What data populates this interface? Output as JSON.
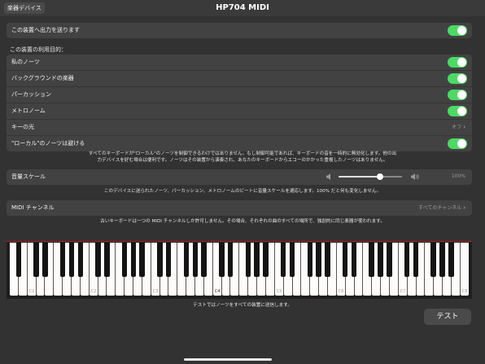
{
  "header": {
    "back_label": "楽器デバイス",
    "title": "HP704 MIDI"
  },
  "send_all": {
    "label": "この装置へ出力を送ります",
    "on": true
  },
  "usage_section": {
    "heading": "この装置の利用目的：",
    "items": [
      {
        "label": "私のノーツ",
        "on": true
      },
      {
        "label": "バックグラウンドの楽器",
        "on": true
      },
      {
        "label": "パーカッション",
        "on": true
      },
      {
        "label": "メトロノーム",
        "on": true
      }
    ],
    "key_light": {
      "label": "キーの光",
      "value": "オフ"
    },
    "avoid_local": {
      "label": "\"ローカル\"のノーツは避ける",
      "on": true
    },
    "note": [
      "すべてのキーボードが\"ローカル\"のノーツを制御できるわけではありません。もし制御可能であれば、キーボードの音を一時的に無効化します。他の出",
      "力デバイスを好む場合は便利です。ノーツはその装置から演奏され、あなたのキーボードからエコーのかかった重複したノーツはありません。"
    ]
  },
  "volume": {
    "label": "音量スケール",
    "value_text": "100%",
    "level": 0.65,
    "note": "このデバイスに送られたノーツ、パーカッション、メトロノームのビートに音量スケールを適応します。100% だと何も変化しません。"
  },
  "midi_channel": {
    "label": "MIDI チャンネル",
    "value": "すべてのチャンネル",
    "note": "古いキーボードは一つの MIDI チャンネルしか許可しません。その場合、それぞれの曲のすべての場所で、独創的に同じ楽器が使われます。"
  },
  "keyboard": {
    "octave_labels": [
      "C1",
      "C2",
      "C3",
      "C4",
      "C5",
      "C6",
      "C7",
      "C8"
    ],
    "white_key_count": 52
  },
  "test": {
    "note": "テストではノーツをすべての装置に送信します。",
    "button_label": "テスト"
  },
  "colors": {
    "toggle_on": "#4cd964",
    "background": "#323232",
    "group": "#424242"
  }
}
